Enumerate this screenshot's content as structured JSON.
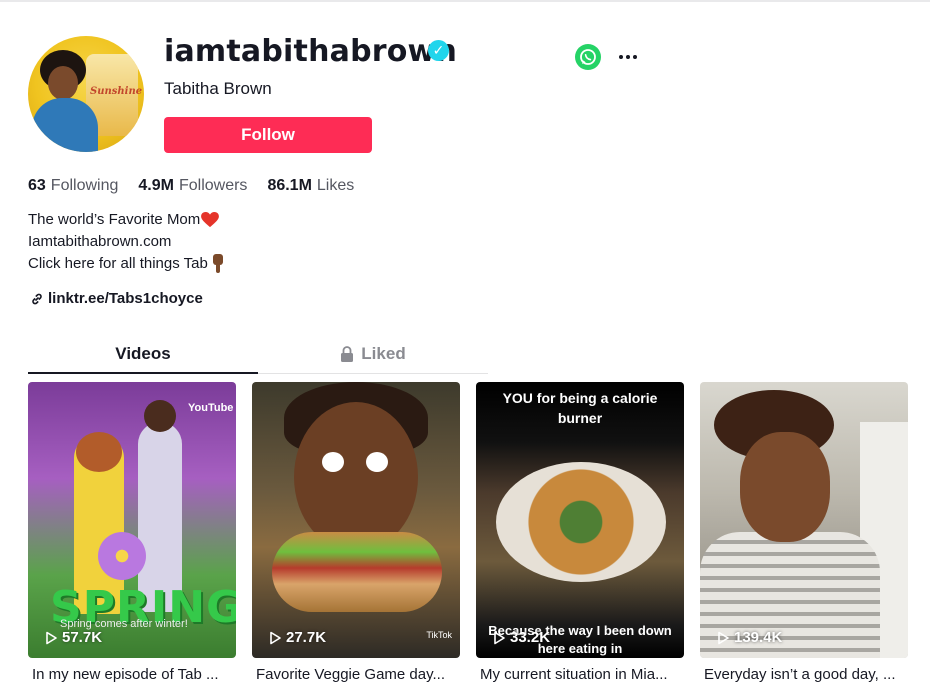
{
  "profile": {
    "username": "iamtabithabrown",
    "nickname": "Tabitha Brown",
    "follow_label": "Follow",
    "avatar_label": "Sunshine"
  },
  "stats": {
    "following_count": "63",
    "following_label": "Following",
    "followers_count": "4.9M",
    "followers_label": "Followers",
    "likes_count": "86.1M",
    "likes_label": "Likes"
  },
  "bio": {
    "line1": "The world’s Favorite Mom",
    "line2": "Iamtabithabrown.com",
    "line3": "Click here for all things Tab"
  },
  "link": "linktr.ee/Tabs1choyce",
  "tabs": {
    "videos": "Videos",
    "liked": "Liked"
  },
  "videos": [
    {
      "views": "57.7K",
      "caption": "In my new episode of Tab ...",
      "overlay_title": "SPRING",
      "overlay_sub": "Spring comes after winter!",
      "overlay_badge": "YouTube"
    },
    {
      "views": "27.7K",
      "caption": "Favorite Veggie Game day...",
      "overlay_badge": "TikTok"
    },
    {
      "views": "33.2K",
      "caption": "My current situation in Mia...",
      "overlay_top": "YOU for being a calorie burner",
      "overlay_bottom": "Because the way I been down here eating in"
    },
    {
      "views": "139.4K",
      "caption": "Everyday isn’t a good day, ..."
    }
  ],
  "colors": {
    "accent": "#fe2c55",
    "verified": "#20d5ec",
    "whatsapp": "#25d366"
  },
  "icons": [
    "verified-badge-icon",
    "whatsapp-icon",
    "more-options-icon",
    "heart-emoji-icon",
    "pointing-down-emoji-icon",
    "link-icon",
    "lock-icon",
    "play-icon"
  ]
}
